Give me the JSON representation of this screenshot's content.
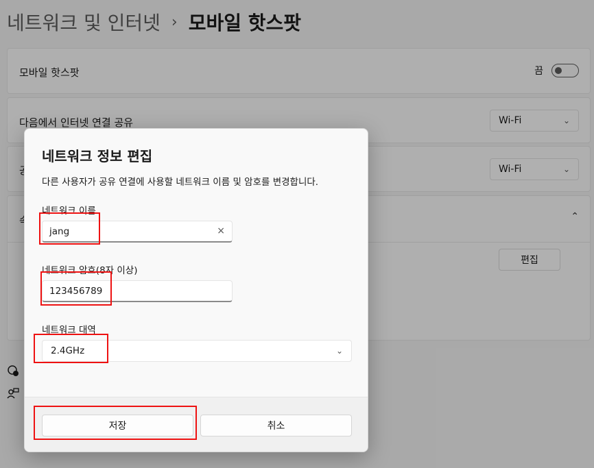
{
  "breadcrumb": {
    "parent": "네트워크 및 인터넷",
    "separator": "›",
    "current": "모바일 핫스팟"
  },
  "settings": {
    "hotspot_label": "모바일 핫스팟",
    "hotspot_state": "끔",
    "share_from_label": "다음에서 인터넷 연결 공유",
    "share_from_value": "Wi-Fi",
    "share_over_label_partial": "공",
    "share_over_value": "Wi-Fi",
    "properties_label_partial": "속",
    "edit_button": "편집"
  },
  "dialog": {
    "title": "네트워크 정보 편집",
    "description": "다른 사용자가 공유 연결에 사용할 네트워크 이름 및 암호를 변경합니다.",
    "name_label": "네트워크 이름",
    "name_value": "jang",
    "clear_glyph": "×",
    "password_label": "네트워크 암호(8자 이상)",
    "password_value": "123456789",
    "band_label": "네트워크 대역",
    "band_value": "2.4GHz",
    "save_button": "저장",
    "cancel_button": "취소"
  },
  "colors": {
    "highlight": "#ee1111",
    "dim_overlay": "rgba(0,0,0,0.30)"
  }
}
